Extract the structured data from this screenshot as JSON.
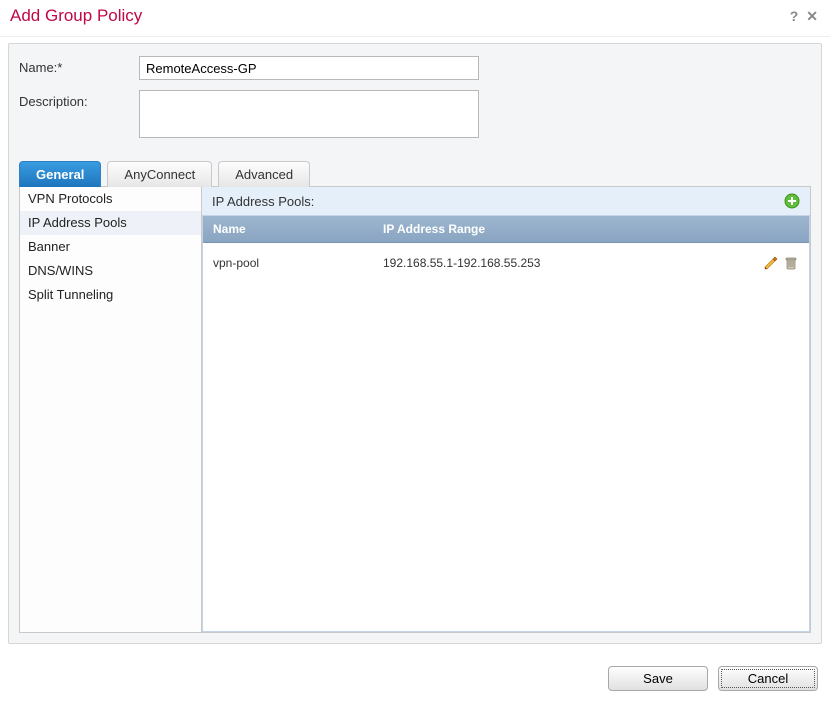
{
  "dialog": {
    "title": "Add Group Policy"
  },
  "form": {
    "name_label": "Name:*",
    "name_value": "RemoteAccess-GP",
    "description_label": "Description:",
    "description_value": ""
  },
  "tabs": [
    {
      "id": "general",
      "label": "General",
      "active": true
    },
    {
      "id": "anyconnect",
      "label": "AnyConnect",
      "active": false
    },
    {
      "id": "advanced",
      "label": "Advanced",
      "active": false
    }
  ],
  "sidebar": {
    "items": [
      {
        "label": "VPN Protocols",
        "selected": false
      },
      {
        "label": "IP Address Pools",
        "selected": true
      },
      {
        "label": "Banner",
        "selected": false
      },
      {
        "label": "DNS/WINS",
        "selected": false
      },
      {
        "label": "Split Tunneling",
        "selected": false
      }
    ]
  },
  "pool_panel": {
    "heading": "IP Address Pools:",
    "columns": {
      "name": "Name",
      "range": "IP Address Range"
    },
    "rows": [
      {
        "name": "vpn-pool",
        "range": "192.168.55.1-192.168.55.253"
      }
    ]
  },
  "footer": {
    "save": "Save",
    "cancel": "Cancel"
  },
  "icons": {
    "help": "?",
    "close": "✕"
  }
}
